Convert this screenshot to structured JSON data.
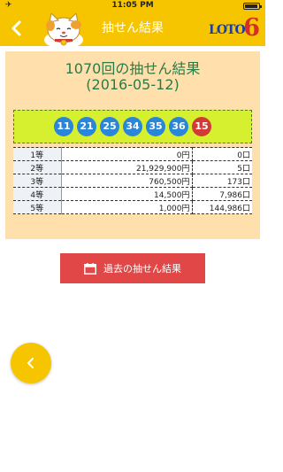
{
  "status_bar": {
    "time": "11:05 PM",
    "battery_level": 0.9
  },
  "header": {
    "title": "抽せん結果",
    "logo": {
      "text": "LOTO",
      "number": "6"
    }
  },
  "result": {
    "title": "1070回の抽せん結果",
    "date": "(2016-05-12)",
    "numbers": [
      "11",
      "21",
      "25",
      "34",
      "35",
      "36"
    ],
    "bonus": "15",
    "prizes": [
      {
        "rank": "1等",
        "amount": "0円",
        "count": "0口"
      },
      {
        "rank": "2等",
        "amount": "21,929,900円",
        "count": "5口"
      },
      {
        "rank": "3等",
        "amount": "760,500円",
        "count": "173口"
      },
      {
        "rank": "4等",
        "amount": "14,500円",
        "count": "7,986口"
      },
      {
        "rank": "5等",
        "amount": "1,000円",
        "count": "144,986口"
      }
    ]
  },
  "past_button": {
    "label": "過去の抽せん結果"
  },
  "colors": {
    "header": "#f7c500",
    "card": "#ffe0ad",
    "ball": "#2a86d8",
    "bonus": "#d23a36",
    "button": "#e04746"
  }
}
